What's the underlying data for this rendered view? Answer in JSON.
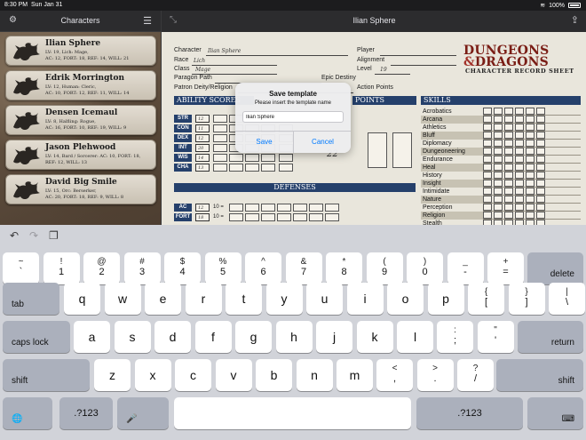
{
  "status_bar": {
    "time": "8:30 PM",
    "date": "Sun Jan 31",
    "battery": "100%"
  },
  "sidebar": {
    "title": "Characters",
    "characters": [
      {
        "name": "Ilian Sphere",
        "line1": "LV: 19, Lich: Mage,",
        "line2": "AC: 12, FORT: 18, REF: 14, WILL: 21"
      },
      {
        "name": "Edrik Morrington",
        "line1": "LV: 12, Human: Cleric,",
        "line2": "AC: 10, FORT: 12, REF: 11, WILL: 14"
      },
      {
        "name": "Densen Icemaul",
        "line1": "LV: 8, Halfling: Rogue,",
        "line2": "AC: 16, FORT: 10, REF: 19, WILL: 9"
      },
      {
        "name": "Jason Plehwood",
        "line1": "LV: 14, Bard / Sorcerer: AC: 10, FORT: 18,",
        "line2": "REF: 12, WILL: 13"
      },
      {
        "name": "David Big Smile",
        "line1": "LV: 15, Orc: Berserker,",
        "line2": "AC: 20, FORT: 18, REF: 9, WILL: 8"
      }
    ]
  },
  "main": {
    "title": "Ilian Sphere",
    "sheet": {
      "labels": {
        "character": "Character",
        "race": "Race",
        "class": "Class",
        "paragon_path": "Paragon Path",
        "patron": "Patron Deity/Religion",
        "player": "Player",
        "alignment": "Alignment",
        "level": "Level",
        "epic_destiny": "Epic Destiny",
        "action_points": "Action Points"
      },
      "values": {
        "character": "Ilian Sphere",
        "race": "Lich",
        "class": "Mage",
        "level": "19"
      },
      "logo_line1": "DUNGEONS",
      "logo_amp": "&",
      "logo_line2": "DRAGONS",
      "logo_sub": "CHARACTER RECORD SHEET",
      "ability_header": "ABILITY SCORES",
      "points_header": "POINTS",
      "defenses_header": "DEFENSES",
      "skills_header": "SKILLS",
      "hp_value": "22",
      "stats": [
        {
          "label": "STR",
          "value": "12"
        },
        {
          "label": "CON",
          "value": "11"
        },
        {
          "label": "DEX",
          "value": "12"
        },
        {
          "label": "INT",
          "value": "20"
        },
        {
          "label": "WIS",
          "value": "14"
        },
        {
          "label": "CHA",
          "value": "13"
        }
      ],
      "defenses": [
        {
          "label": "AC",
          "value": "12",
          "suffix": "10 ="
        },
        {
          "label": "FORT",
          "value": "18",
          "suffix": "10 ="
        }
      ],
      "skills": [
        "Acrobatics",
        "Arcana",
        "Athletics",
        "Bluff",
        "Diplomacy",
        "Dungeoneering",
        "Endurance",
        "Heal",
        "History",
        "Insight",
        "Intimidate",
        "Nature",
        "Perception",
        "Religion",
        "Stealth"
      ]
    }
  },
  "dialog": {
    "title": "Save template",
    "message": "Please insert the template name",
    "input_value": "Ilian Sphere",
    "save_label": "Save",
    "cancel_label": "Cancel"
  },
  "keyboard": {
    "row1": [
      {
        "top": "~",
        "bot": "`"
      },
      {
        "top": "!",
        "bot": "1"
      },
      {
        "top": "@",
        "bot": "2"
      },
      {
        "top": "#",
        "bot": "3"
      },
      {
        "top": "$",
        "bot": "4"
      },
      {
        "top": "%",
        "bot": "5"
      },
      {
        "top": "^",
        "bot": "6"
      },
      {
        "top": "&",
        "bot": "7"
      },
      {
        "top": "*",
        "bot": "8"
      },
      {
        "top": "(",
        "bot": "9"
      },
      {
        "top": ")",
        "bot": "0"
      },
      {
        "top": "_",
        "bot": "-"
      },
      {
        "top": "+",
        "bot": "="
      }
    ],
    "delete": "delete",
    "tab": "tab",
    "row2": [
      "q",
      "w",
      "e",
      "r",
      "t",
      "y",
      "u",
      "i",
      "o",
      "p"
    ],
    "row2_sym": [
      {
        "top": "{",
        "bot": "["
      },
      {
        "top": "}",
        "bot": "]"
      },
      {
        "top": "|",
        "bot": "\\"
      }
    ],
    "caps": "caps lock",
    "row3": [
      "a",
      "s",
      "d",
      "f",
      "g",
      "h",
      "j",
      "k",
      "l"
    ],
    "row3_sym": [
      {
        "top": ":",
        "bot": ";"
      },
      {
        "top": "\"",
        "bot": "'"
      }
    ],
    "return": "return",
    "shift": "shift",
    "row4": [
      "z",
      "x",
      "c",
      "v",
      "b",
      "n",
      "m"
    ],
    "row4_sym": [
      {
        "top": "<",
        "bot": ","
      },
      {
        "top": ">",
        "bot": "."
      },
      {
        "top": "?",
        "bot": "/"
      }
    ],
    "num_label": ".?123",
    "globe": "🌐",
    "mic": "🎤",
    "hide": "⌨"
  }
}
